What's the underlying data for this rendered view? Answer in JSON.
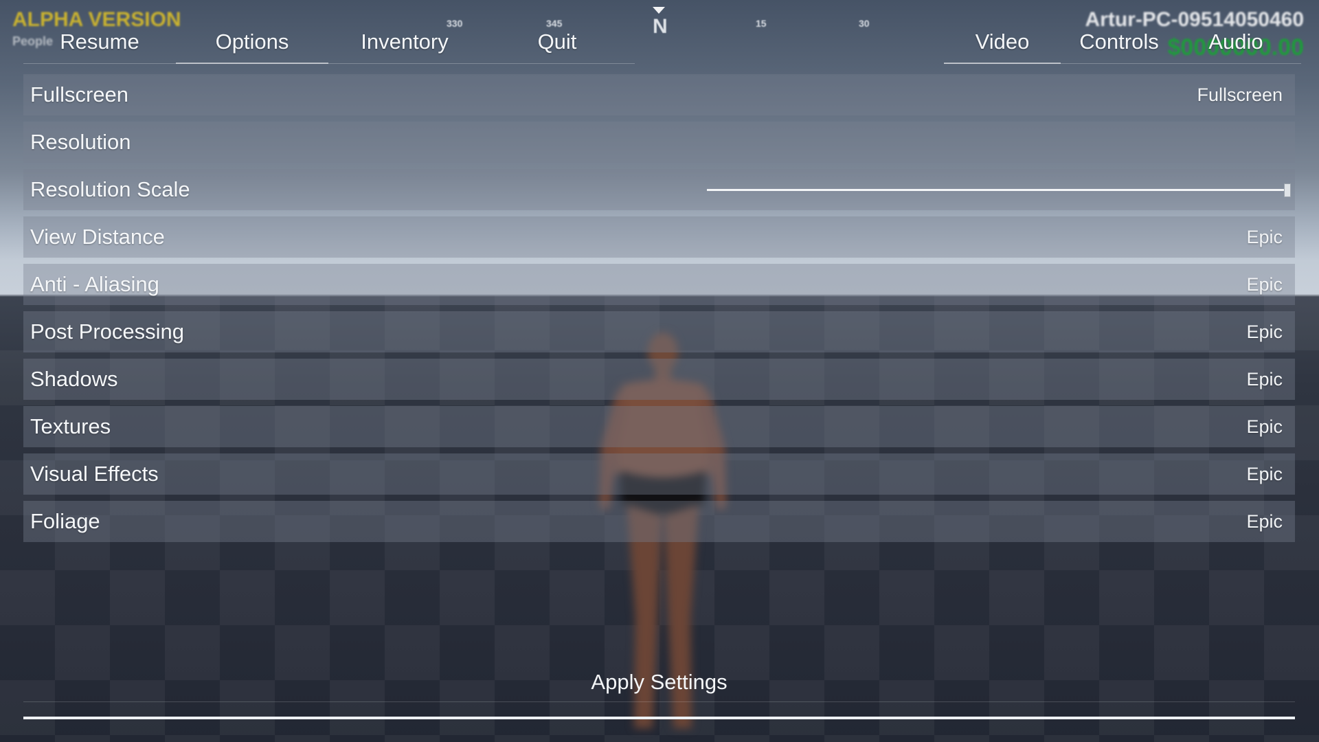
{
  "hud": {
    "alpha_text": "ALPHA VERSION",
    "people_text": "People",
    "pc_name": "Artur-PC-09514050460",
    "money": "$0000000.00"
  },
  "compass": {
    "ticks": [
      "330",
      "345",
      "15",
      "30"
    ],
    "heading": "N"
  },
  "nav": {
    "left_tabs": [
      {
        "label": "Resume"
      },
      {
        "label": "Options",
        "active": true
      },
      {
        "label": "Inventory"
      },
      {
        "label": "Quit"
      }
    ],
    "right_tabs": [
      {
        "label": "Video",
        "active": true
      },
      {
        "label": "Controls"
      },
      {
        "label": "Audio"
      }
    ]
  },
  "settings": [
    {
      "label": "Fullscreen",
      "value": "Fullscreen"
    },
    {
      "label": "Resolution",
      "value": ""
    },
    {
      "label": "Resolution Scale",
      "slider_fraction": 1.0
    },
    {
      "label": "View Distance",
      "value": "Epic"
    },
    {
      "label": "Anti - Aliasing",
      "value": "Epic"
    },
    {
      "label": "Post Processing",
      "value": "Epic"
    },
    {
      "label": "Shadows",
      "value": "Epic"
    },
    {
      "label": "Textures",
      "value": "Epic"
    },
    {
      "label": "Visual Effects",
      "value": "Epic"
    },
    {
      "label": "Foliage",
      "value": "Epic"
    }
  ],
  "apply_label": "Apply Settings",
  "colors": {
    "alpha_text": "#c9b230",
    "money_text": "#1f9a3c",
    "row_bg": "#78828f",
    "text": "#f4f6f8"
  }
}
